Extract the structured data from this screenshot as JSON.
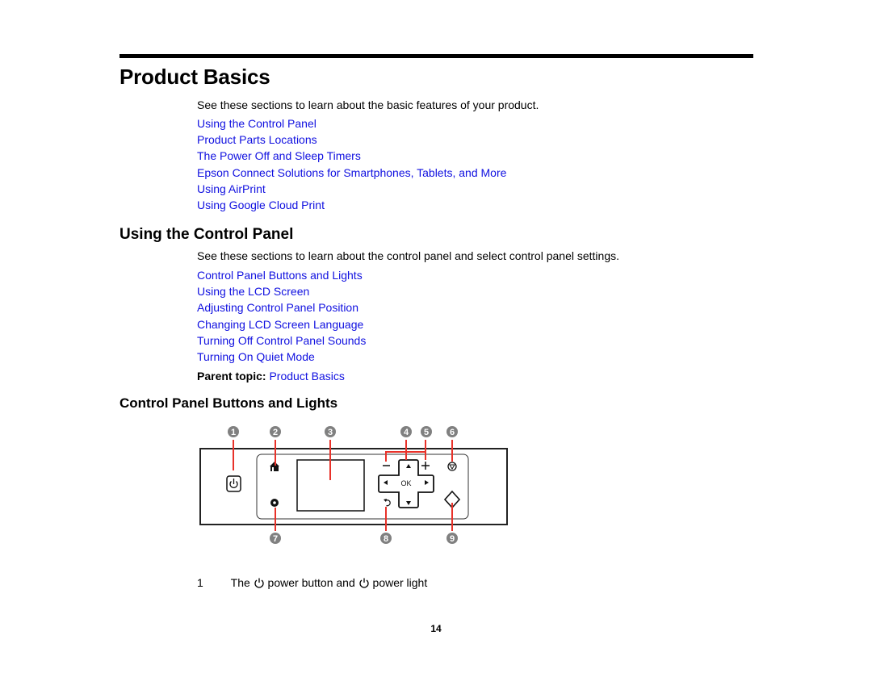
{
  "page": {
    "title": "Product Basics",
    "intro": "See these sections to learn about the basic features of your product.",
    "links": [
      "Using the Control Panel",
      "Product Parts Locations",
      "The Power Off and Sleep Timers",
      "Epson Connect Solutions for Smartphones, Tablets, and More",
      "Using AirPrint",
      "Using Google Cloud Print"
    ]
  },
  "section": {
    "title": "Using the Control Panel",
    "intro": "See these sections to learn about the control panel and select control panel settings.",
    "links": [
      "Control Panel Buttons and Lights",
      "Using the LCD Screen",
      "Adjusting Control Panel Position",
      "Changing LCD Screen Language",
      "Turning Off Control Panel Sounds",
      "Turning On Quiet Mode"
    ],
    "parent_label": "Parent topic:",
    "parent_link": "Product Basics"
  },
  "subsection": {
    "title": "Control Panel Buttons and Lights",
    "diagram": {
      "callouts": [
        "1",
        "2",
        "3",
        "4",
        "5",
        "6",
        "7",
        "8",
        "9"
      ],
      "ok_label": "OK",
      "accent_color": "#e8322a",
      "callout_color": "#808080"
    },
    "items": [
      {
        "number": "1",
        "text_before": "The",
        "text_middle": "power button and",
        "text_after": "power light",
        "icon": "power-icon"
      }
    ]
  },
  "footer": {
    "page_number": "14"
  }
}
